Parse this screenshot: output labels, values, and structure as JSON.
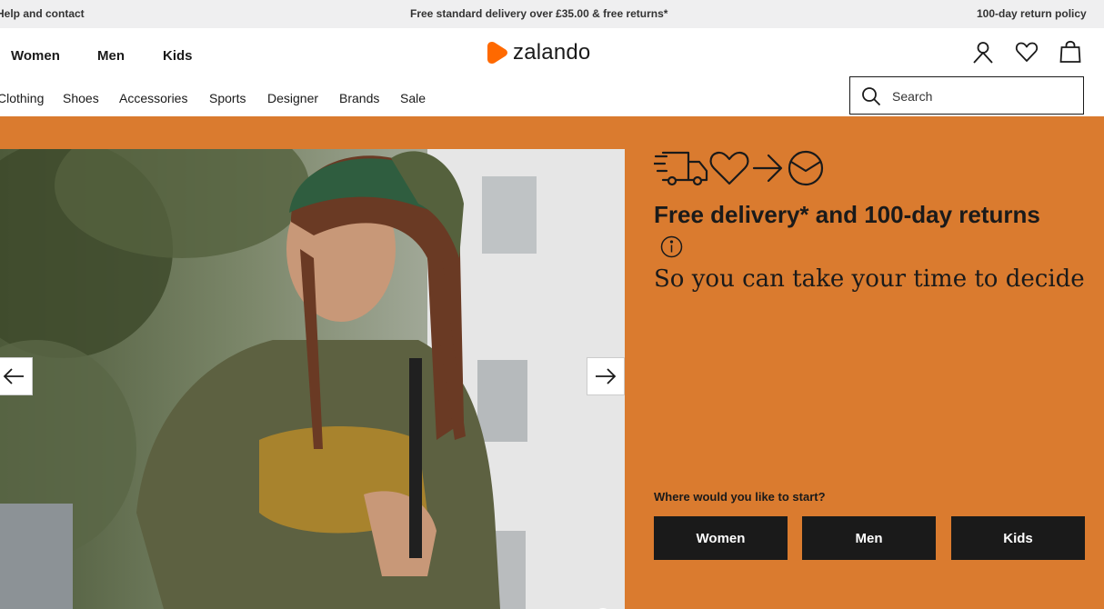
{
  "topbar": {
    "help": "Help and contact",
    "delivery": "Free standard delivery over £35.00 & free returns*",
    "returns": "100-day return policy"
  },
  "header": {
    "genders": [
      "Women",
      "Men",
      "Kids"
    ],
    "logo": "zalando",
    "nav": [
      "Clothing",
      "Shoes",
      "Accessories",
      "Sports",
      "Designer",
      "Brands",
      "Sale"
    ],
    "search_placeholder": "Search"
  },
  "hero": {
    "title": "Free delivery* and 100-day returns",
    "subtitle": "So you can take your time to decide",
    "question": "Where would you like to start?",
    "buttons": [
      "Women",
      "Men",
      "Kids"
    ]
  },
  "colors": {
    "brand_orange": "#ff6900",
    "hero_background": "#da7b2f",
    "topbar_background": "#efeff0",
    "button_background": "#1a1a1a"
  },
  "icons": [
    "user-icon",
    "heart-icon",
    "bag-icon",
    "search-icon",
    "delivery-truck-icon",
    "returns-heart-icon",
    "arrow-right-icon",
    "parcel-icon",
    "info-icon",
    "arrow-left-icon",
    "pause-icon"
  ]
}
